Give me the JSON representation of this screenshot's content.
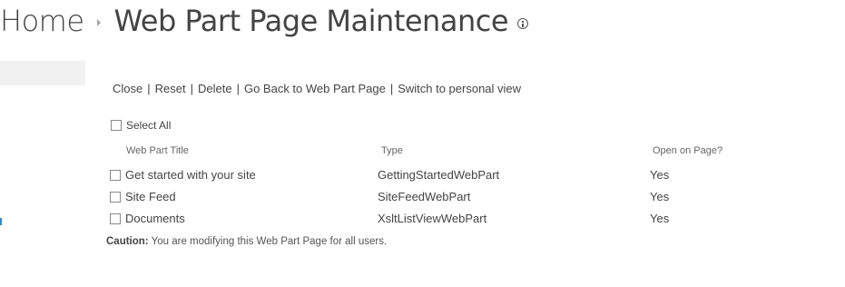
{
  "breadcrumb": {
    "home": "Home",
    "title": "Web Part Page Maintenance"
  },
  "toolbar": {
    "close": "Close",
    "reset": "Reset",
    "delete": "Delete",
    "go_back": "Go Back to Web Part Page",
    "switch_view": "Switch to personal view",
    "separator": "|"
  },
  "select_all": "Select All",
  "columns": {
    "title": "Web Part Title",
    "type": "Type",
    "open": "Open on Page?"
  },
  "rows": [
    {
      "title": "Get started with your site",
      "type": "GettingStartedWebPart",
      "open": "Yes"
    },
    {
      "title": "Site Feed",
      "type": "SiteFeedWebPart",
      "open": "Yes"
    },
    {
      "title": "Documents",
      "type": "XsltListViewWebPart",
      "open": "Yes"
    }
  ],
  "caution": {
    "label": "Caution:",
    "text": "You are modifying this Web Part Page for all users."
  },
  "icons": {
    "breadcrumb_separator": "triangle-right-icon",
    "info": "info-icon"
  },
  "colors": {
    "text": "#444444",
    "nav_block": "#f1f1f1",
    "accent": "#2a8dd4"
  }
}
